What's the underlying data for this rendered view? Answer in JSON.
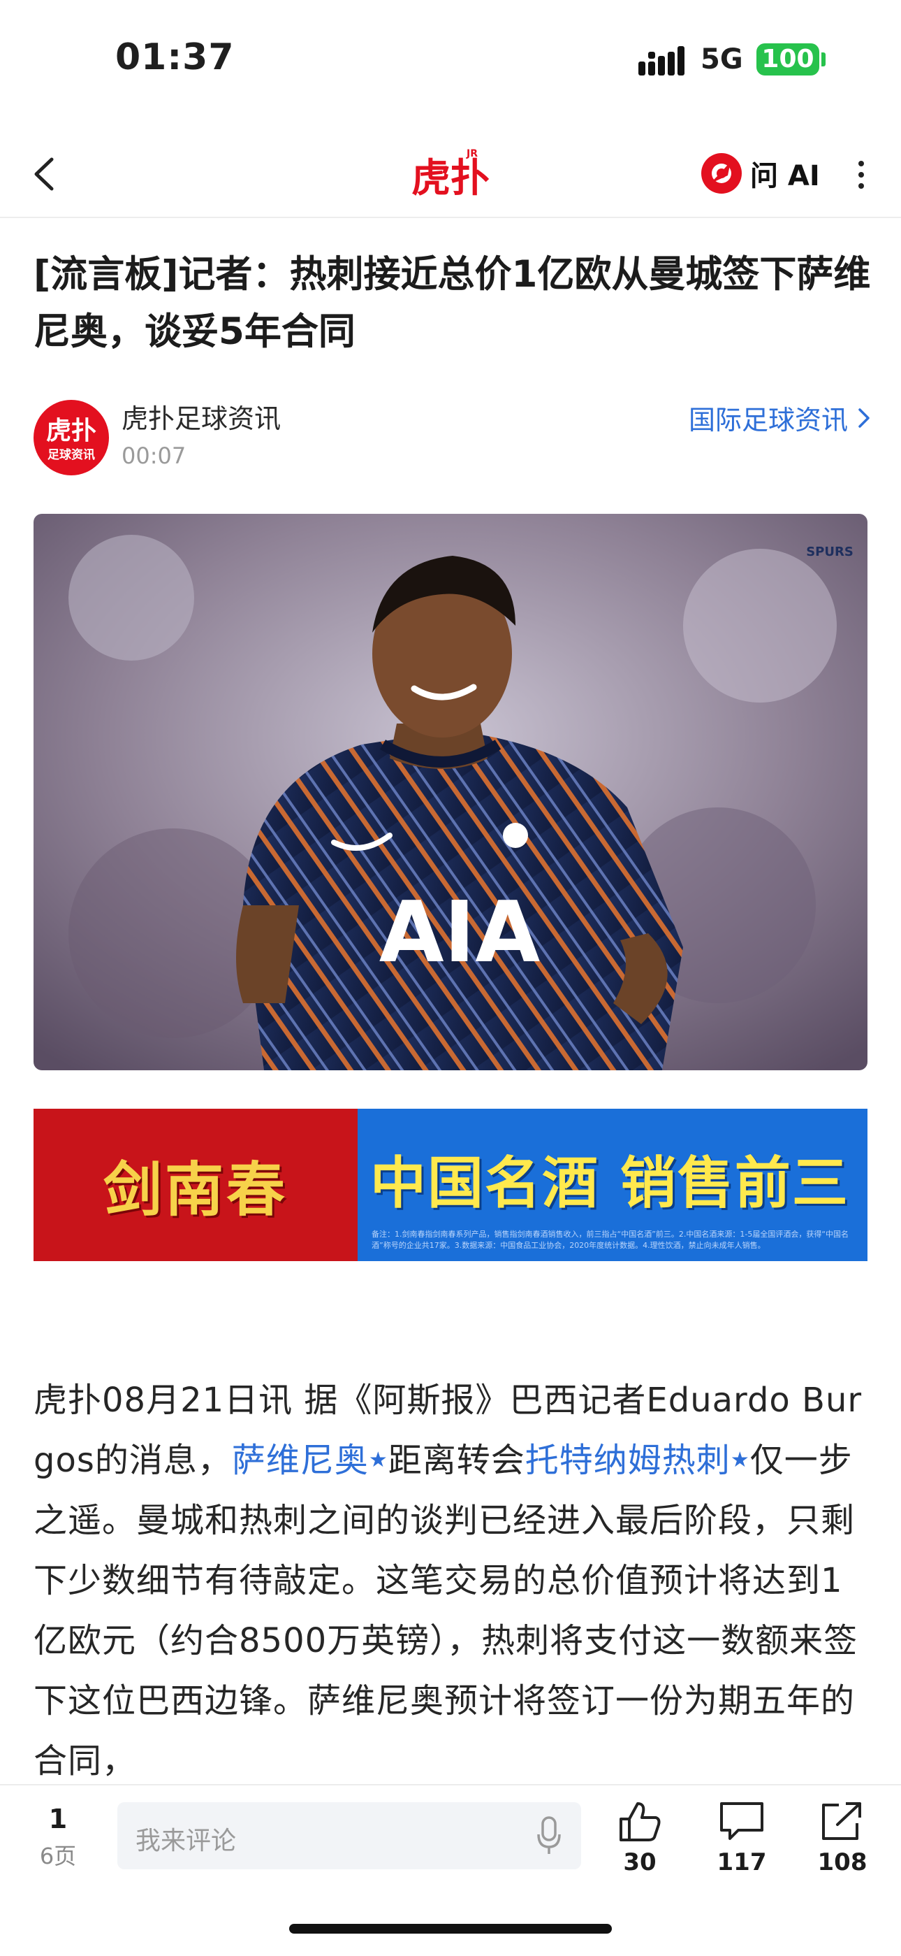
{
  "status_bar": {
    "time": "01:37",
    "network": "5G",
    "battery": "100"
  },
  "header": {
    "logo_text": "虎扑",
    "logo_sup": "JR",
    "ai_label": "问 AI"
  },
  "article": {
    "title": "[流言板]记者：热刺接近总价1亿欧从曼城签下萨维尼奥，谈妥5年合同",
    "author": "虎扑足球资讯",
    "avatar_text_top": "虎扑",
    "avatar_text_bottom": "足球资讯",
    "time": "00:07",
    "category": "国际足球资讯",
    "image_logo": "SPURS",
    "jersey_text": "AIA"
  },
  "ad": {
    "brand": "剑南春",
    "slogan": "中国名酒 销售前三",
    "fine_print": "备注：1.剑南春指剑南春系列产品，销售指剑南春酒销售收入，前三指占“中国名酒”前三。2.中国名酒来源：1-5届全国评酒会，获得“中国名酒”称号的企业共17家。3.数据来源：中国食品工业协会，2020年度统计数据。4.理性饮酒，禁止向未成年人销售。"
  },
  "body": {
    "p1": "虎扑08月21日讯 据《阿斯报》巴西记者Eduardo Burgos的消息，",
    "link1": "萨维尼奥",
    "p2": "距离转会",
    "link2": "托特纳姆热刺",
    "p3": "仅一步之遥。曼城和热刺之间的谈判已经进入最后阶段，只剩下少数细节有待敲定。这笔交易的总价值预计将达到1亿欧元（约合8500万英镑），热刺将支付这一数额来签下这位巴西边锋。萨维尼奥预计将签订一份为期五年的合同，"
  },
  "bottom_bar": {
    "current_page": "1",
    "total_pages": "6页",
    "comment_placeholder": "我来评论",
    "likes": "30",
    "comments": "117",
    "shares": "108"
  },
  "colors": {
    "brand_red": "#e3101f",
    "link_blue": "#2e6fd8",
    "battery_green": "#27c24c"
  }
}
